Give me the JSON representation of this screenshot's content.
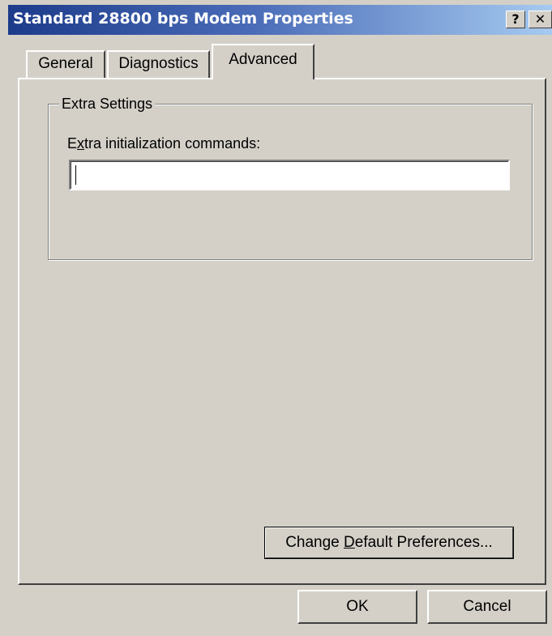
{
  "dialog": {
    "title": "Standard 28800 bps Modem Properties",
    "help_glyph": "?",
    "close_glyph": "✕"
  },
  "tabs": [
    {
      "label": "General",
      "active": false
    },
    {
      "label": "Diagnostics",
      "active": false
    },
    {
      "label": "Advanced",
      "active": true
    }
  ],
  "extra_settings": {
    "group_label": "Extra Settings",
    "field_label_pre": "E",
    "field_label_mnemonic": "x",
    "field_label_post": "tra initialization commands:",
    "input_value": "",
    "input_placeholder": ""
  },
  "buttons": {
    "change_prefs_pre": "Change ",
    "change_prefs_mnemonic": "D",
    "change_prefs_post": "efault Preferences...",
    "ok": "OK",
    "cancel": "Cancel"
  },
  "colors": {
    "titlebar_start": "#1c3b8a",
    "titlebar_end": "#a6caf0",
    "face": "#d4d0c8"
  },
  "icons": {
    "help": "help-icon",
    "close": "close-icon"
  }
}
